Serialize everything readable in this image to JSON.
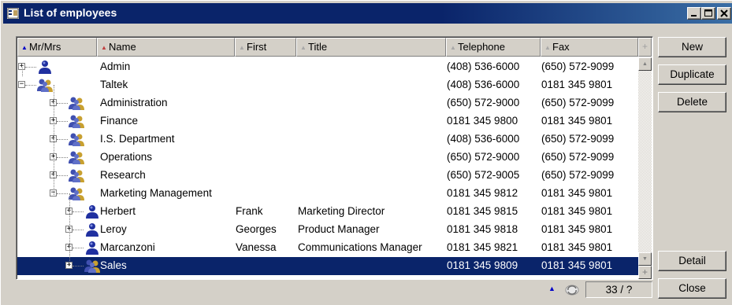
{
  "window": {
    "title": "List of employees"
  },
  "columns": [
    {
      "label": "Mr/Mrs",
      "sort": "active"
    },
    {
      "label": "Name",
      "sort": "red"
    },
    {
      "label": "First",
      "sort": "none"
    },
    {
      "label": "Title",
      "sort": "none"
    },
    {
      "label": "Telephone",
      "sort": "none"
    },
    {
      "label": "Fax",
      "sort": "none"
    }
  ],
  "rows": [
    {
      "icon": "person-icon",
      "level": 0,
      "expander": "+",
      "name": "Admin",
      "first": "",
      "title": "",
      "telephone": "(408) 536-6000",
      "fax": "(650) 572-9099"
    },
    {
      "icon": "group-icon",
      "level": 0,
      "expander": "−",
      "name": "Taltek",
      "first": "",
      "title": "",
      "telephone": "(408) 536-6000",
      "fax": "0181 345 9801"
    },
    {
      "icon": "group-icon",
      "level": 1,
      "expander": "+",
      "name": "Administration",
      "first": "",
      "title": "",
      "telephone": "(650) 572-9000",
      "fax": "(650) 572-9099"
    },
    {
      "icon": "group-icon",
      "level": 1,
      "expander": "+",
      "name": "Finance",
      "first": "",
      "title": "",
      "telephone": "0181 345 9800",
      "fax": "0181 345 9801"
    },
    {
      "icon": "group-icon",
      "level": 1,
      "expander": "+",
      "name": "I.S. Department",
      "first": "",
      "title": "",
      "telephone": "(408) 536-6000",
      "fax": "(650) 572-9099"
    },
    {
      "icon": "group-icon",
      "level": 1,
      "expander": "+",
      "name": "Operations",
      "first": "",
      "title": "",
      "telephone": "(650) 572-9000",
      "fax": "(650) 572-9099"
    },
    {
      "icon": "group-icon",
      "level": 1,
      "expander": "+",
      "name": "Research",
      "first": "",
      "title": "",
      "telephone": "(650) 572-9005",
      "fax": "(650) 572-9099"
    },
    {
      "icon": "group-icon",
      "level": 1,
      "expander": "−",
      "name": "Marketing Management",
      "first": "",
      "title": "",
      "telephone": "0181 345 9812",
      "fax": "0181 345 9801"
    },
    {
      "icon": "person-icon",
      "level": 2,
      "expander": "+",
      "name": "Herbert",
      "first": "Frank",
      "title": "Marketing Director",
      "telephone": "0181 345 9815",
      "fax": "0181 345 9801"
    },
    {
      "icon": "person-icon",
      "level": 2,
      "expander": "+",
      "name": "Leroy",
      "first": "Georges",
      "title": "Product Manager",
      "telephone": "0181 345 9818",
      "fax": "0181 345 9801"
    },
    {
      "icon": "person-icon",
      "level": 2,
      "expander": "+",
      "name": "Marcanzoni",
      "first": "Vanessa",
      "title": "Communications Manager",
      "telephone": "0181 345 9821",
      "fax": "0181 345 9801"
    },
    {
      "icon": "group-icon",
      "level": 2,
      "expander": "+",
      "name": "Sales",
      "first": "",
      "title": "",
      "telephone": "0181 345 9809",
      "fax": "0181 345 9801",
      "selected": true
    }
  ],
  "buttons": {
    "new": "New",
    "duplicate": "Duplicate",
    "delete": "Delete",
    "detail": "Detail",
    "close": "Close"
  },
  "status": {
    "count": "33 / ?"
  },
  "colors": {
    "titlebar": "#0a246a",
    "selection": "#0a246a",
    "face": "#d4d0c8"
  }
}
